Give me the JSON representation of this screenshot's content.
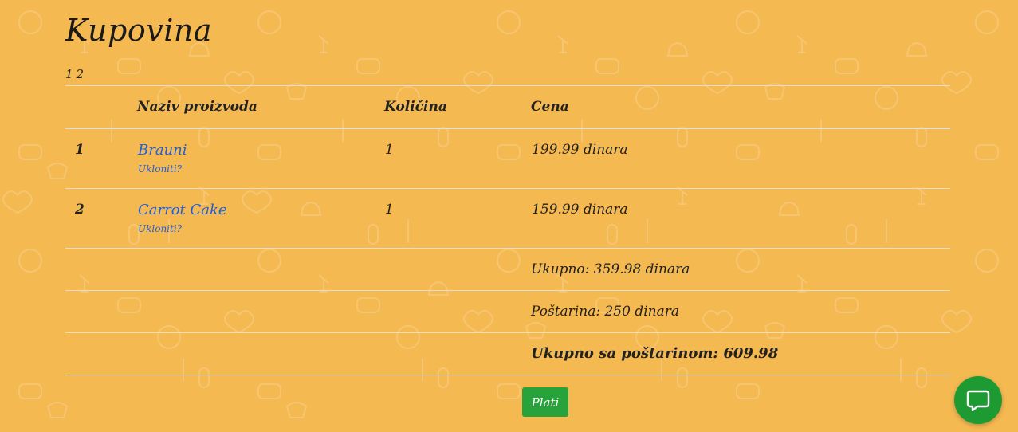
{
  "page": {
    "title": "Kupovina",
    "pager": [
      "1",
      "2"
    ]
  },
  "table": {
    "headers": {
      "num": "",
      "name": "Naziv proizvoda",
      "quantity": "Količina",
      "price": "Cena"
    },
    "rows": [
      {
        "num": "1",
        "name": "Brauni",
        "remove": "Ukloniti?",
        "quantity": "1",
        "price": "199.99 dinara"
      },
      {
        "num": "2",
        "name": "Carrot Cake",
        "remove": "Ukloniti?",
        "quantity": "1",
        "price": "159.99 dinara"
      }
    ],
    "subtotal": "Ukupno: 359.98 dinara",
    "shipping": "Poštarina: 250 dinara",
    "total": "Ukupno sa poštarinom: 609.98"
  },
  "actions": {
    "pay_label": "Plati"
  },
  "colors": {
    "background": "#f5b952",
    "link": "#1f5fd8",
    "pay_button": "#28a33c",
    "chat_button": "#1d9a32"
  },
  "icons": {
    "chat": "chat-bubble-icon"
  }
}
